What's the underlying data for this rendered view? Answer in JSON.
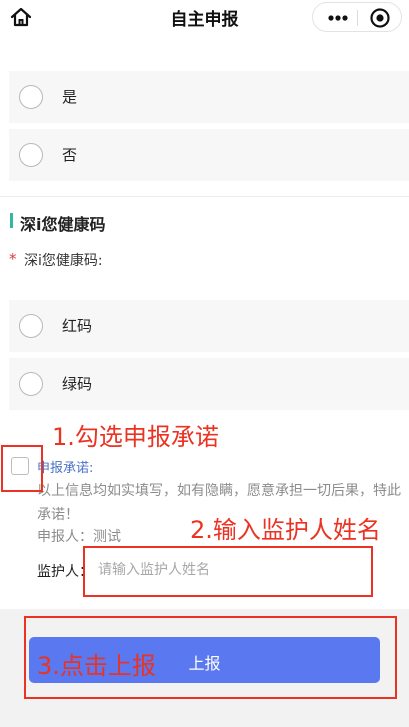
{
  "nav": {
    "title": "自主申报",
    "home_icon": "home-icon",
    "more_icon": "more-dots-icon",
    "close_icon": "target-circle-icon"
  },
  "question_options": [
    {
      "label": "是"
    },
    {
      "label": "否"
    }
  ],
  "section": {
    "title": "深i您健康码",
    "required_mark": "*",
    "field_label": "深i您健康码:"
  },
  "health_code_options": [
    {
      "label": "红码"
    },
    {
      "label": "绿码"
    }
  ],
  "commitment": {
    "title": "申报承诺:",
    "text": "以上信息均如实填写，如有隐瞒，愿意承担一切后果，特此承诺！",
    "applicant": "申报人：测试"
  },
  "guardian": {
    "label": "监护人：",
    "placeholder": "请输入监护人姓名",
    "value": ""
  },
  "submit": {
    "label": "上报"
  },
  "annotations": {
    "step1": "1.勾选申报承诺",
    "step2": "2.输入监护人姓名",
    "step3": "3.点击上报"
  },
  "colors": {
    "accent": "#5a78f0",
    "section_bar": "#35b6a0",
    "required": "#e23b3b",
    "commit_title": "#4a72c8",
    "annotation": "#ea3323"
  }
}
